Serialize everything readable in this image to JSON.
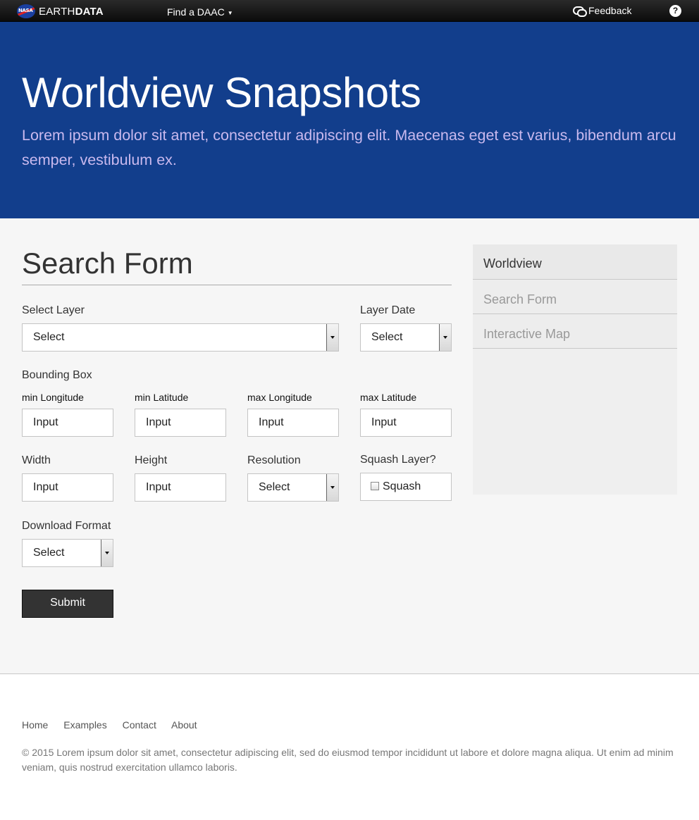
{
  "topbar": {
    "logo_badge": "NASA",
    "brand_light": "EARTH",
    "brand_bold": "DATA",
    "find_daac": "Find a DAAC",
    "feedback": "Feedback",
    "help": "?"
  },
  "hero": {
    "title": "Worldview Snapshots",
    "subtitle": "Lorem ipsum dolor sit amet, consectetur adipiscing elit. Maecenas eget est varius, bibendum arcu semper, vestibulum ex.",
    "background_color": "#123e8c"
  },
  "form": {
    "title": "Search Form",
    "select_layer": {
      "label": "Select Layer",
      "value": "Select"
    },
    "layer_date": {
      "label": "Layer Date",
      "value": "Select"
    },
    "bounding_box": {
      "label": "Bounding Box",
      "min_longitude": {
        "label": "min Longitude",
        "value": "Input"
      },
      "min_latitude": {
        "label": "min Latitude",
        "value": "Input"
      },
      "max_longitude": {
        "label": "max Longitude",
        "value": "Input"
      },
      "max_latitude": {
        "label": "max Latitude",
        "value": "Input"
      }
    },
    "width": {
      "label": "Width",
      "value": "Input"
    },
    "height": {
      "label": "Height",
      "value": "Input"
    },
    "resolution": {
      "label": "Resolution",
      "value": "Select"
    },
    "squash_layer": {
      "label": "Squash Layer?",
      "checkbox_label": "Squash",
      "checked": false
    },
    "download_format": {
      "label": "Download Format",
      "value": "Select"
    },
    "submit_label": "Submit"
  },
  "sidebar": {
    "items": [
      {
        "label": "Worldview",
        "active": true
      },
      {
        "label": "Search Form",
        "active": false
      },
      {
        "label": "Interactive Map",
        "active": false
      }
    ]
  },
  "footer": {
    "links": [
      "Home",
      "Examples",
      "Contact",
      "About"
    ],
    "copyright": "© 2015 Lorem ipsum dolor sit amet, consectetur adipiscing elit, sed do eiusmod tempor incididunt ut labore et dolore magna aliqua. Ut enim ad minim veniam, quis nostrud exercitation ullamco laboris."
  }
}
